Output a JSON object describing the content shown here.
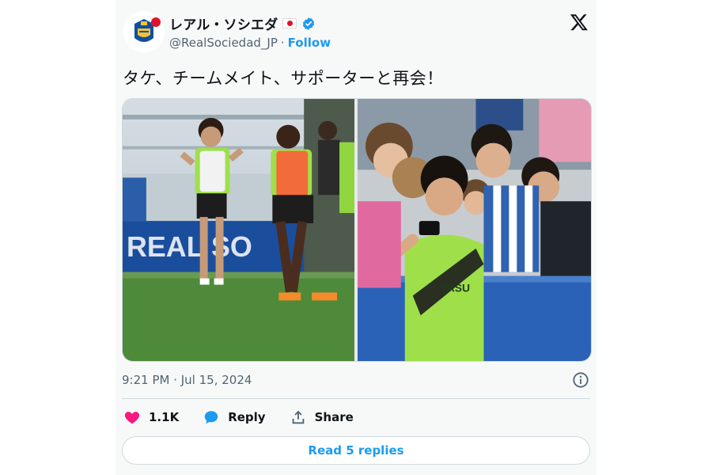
{
  "author": {
    "display_name": "レアル・ソシエダ",
    "handle": "@RealSociedad_JP",
    "separator": "·",
    "follow_label": "Follow",
    "avatar_icon": "real-sociedad-crest-icon",
    "badge_icon": "verified-badge-icon"
  },
  "tweet": {
    "text": "タケ、チームメイト、サポーターと再会！",
    "timestamp": "9:21 PM · Jul 15, 2024"
  },
  "media": {
    "photos": [
      {
        "description_icon": "training-photo"
      },
      {
        "description_icon": "fans-selfie-photo"
      }
    ]
  },
  "actions": {
    "like_count": "1.1K",
    "reply_label": "Reply",
    "share_label": "Share"
  },
  "read_replies_label": "Read 5 replies",
  "colors": {
    "accent": "#1d9bf0",
    "like": "#f91880",
    "muted": "#536471",
    "background": "#f7f9f9"
  }
}
